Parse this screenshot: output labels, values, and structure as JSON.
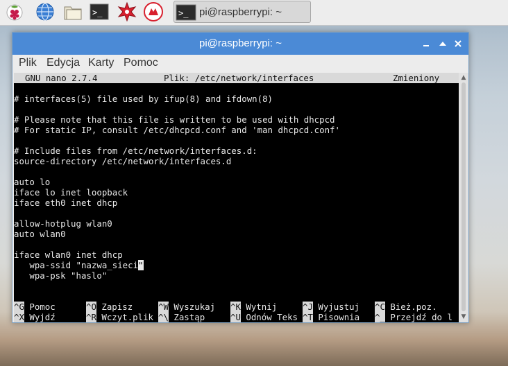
{
  "panel": {
    "task_title": "pi@raspberrypi: ~",
    "launchers": [
      "raspberry-menu-icon",
      "web-browser-icon",
      "file-manager-icon",
      "terminal-icon",
      "math-kernel-icon",
      "wolfram-icon"
    ]
  },
  "window": {
    "title": "pi@raspberrypi: ~",
    "menu": [
      "Plik",
      "Edycja",
      "Karty",
      "Pomoc"
    ]
  },
  "nano": {
    "header_app": "GNU nano 2.7.4",
    "header_file": "Plik: /etc/network/interfaces",
    "header_status": "Zmieniony",
    "lines": [
      "",
      "# interfaces(5) file used by ifup(8) and ifdown(8)",
      "",
      "# Please note that this file is written to be used with dhcpcd",
      "# For static IP, consult /etc/dhcpcd.conf and 'man dhcpcd.conf'",
      "",
      "# Include files from /etc/network/interfaces.d:",
      "source-directory /etc/network/interfaces.d",
      "",
      "auto lo",
      "iface lo inet loopback",
      "iface eth0 inet dhcp",
      "",
      "allow-hotplug wlan0",
      "auto wlan0",
      "",
      "iface wlan0 inet dhcp",
      "   wpa-ssid \"nazwa_sieci",
      "   wpa-psk \"haslo\""
    ],
    "cursor_char": "\"",
    "shortcuts_row1": [
      {
        "key": "^G",
        "label": "Pomoc"
      },
      {
        "key": "^O",
        "label": "Zapisz"
      },
      {
        "key": "^W",
        "label": "Wyszukaj"
      },
      {
        "key": "^K",
        "label": "Wytnij"
      },
      {
        "key": "^J",
        "label": "Wyjustuj"
      },
      {
        "key": "^C",
        "label": "Bież.poz."
      }
    ],
    "shortcuts_row2": [
      {
        "key": "^X",
        "label": "Wyjdź"
      },
      {
        "key": "^R",
        "label": "Wczyt.plik"
      },
      {
        "key": "^\\",
        "label": "Zastąp"
      },
      {
        "key": "^U",
        "label": "Odnów Teks"
      },
      {
        "key": "^T",
        "label": "Pisownia"
      },
      {
        "key": "^_",
        "label": "Przejdź do l"
      }
    ]
  },
  "colors": {
    "titlebar": "#4b8ad6",
    "terminal_bg": "#000000",
    "terminal_fg": "#e8e8e8",
    "nano_bar": "#d9d9d9"
  }
}
